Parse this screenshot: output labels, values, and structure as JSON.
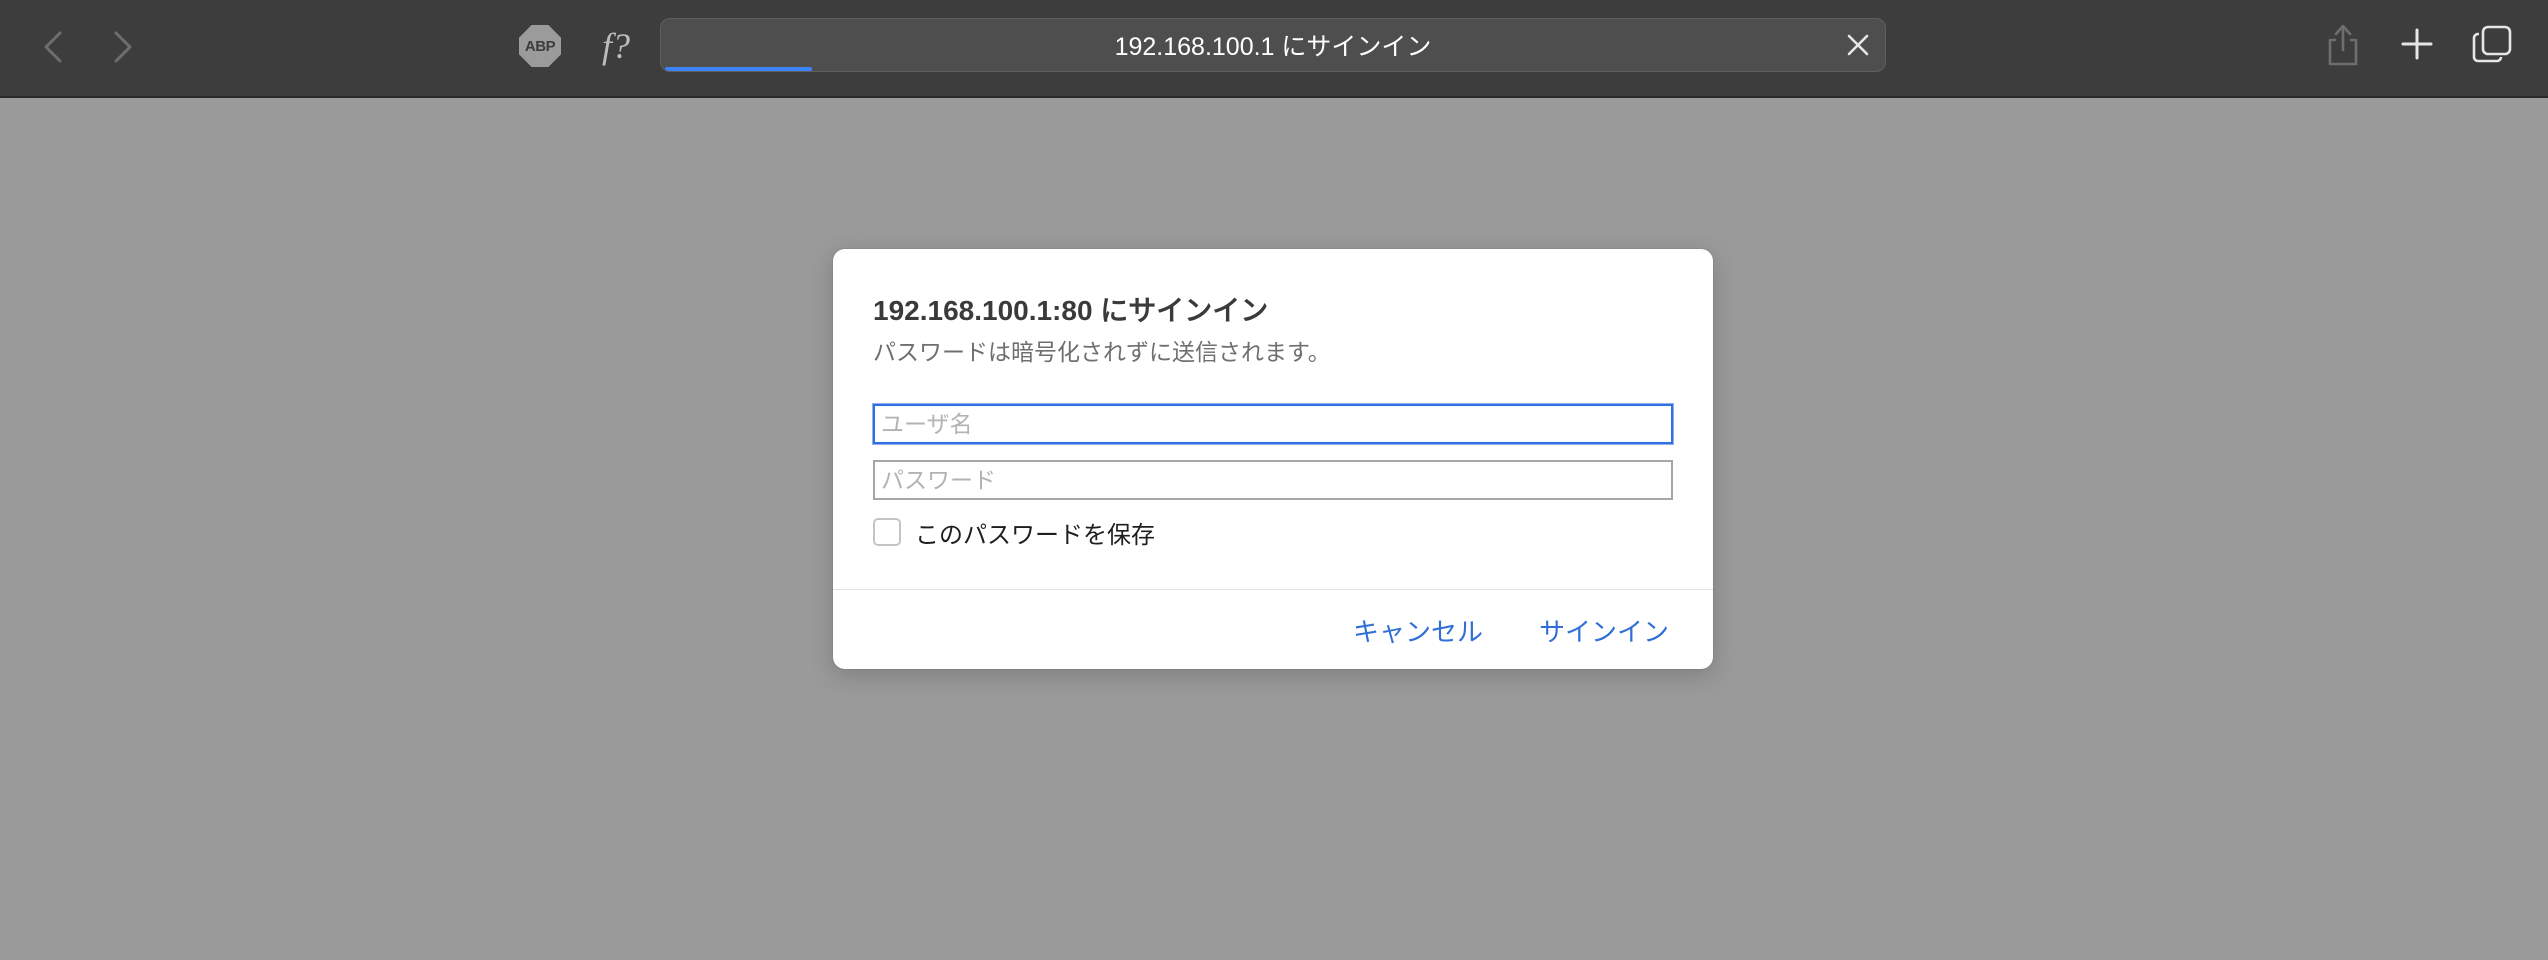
{
  "toolbar": {
    "address_text": "192.168.100.1 にサインイン",
    "load_progress": 0.12,
    "abp_label": "ABP",
    "fx_label": "f?"
  },
  "dialog": {
    "title": "192.168.100.1:80 にサインイン",
    "subtitle": "パスワードは暗号化されずに送信されます。",
    "username_placeholder": "ユーザ名",
    "password_placeholder": "パスワード",
    "save_password_label": "このパスワードを保存",
    "save_password_checked": false,
    "cancel_label": "キャンセル",
    "signin_label": "サインイン"
  },
  "colors": {
    "toolbar_bg": "#3d3d3d",
    "page_bg": "#9a9a9a",
    "accent": "#2f6fd6",
    "progress": "#3e82f7"
  },
  "icons": {
    "back": "chevron-left-icon",
    "forward": "chevron-right-icon",
    "adblock": "abp-icon",
    "stop": "close-icon",
    "share": "share-icon",
    "new_tab": "plus-icon",
    "tabs": "tab-overview-icon"
  }
}
